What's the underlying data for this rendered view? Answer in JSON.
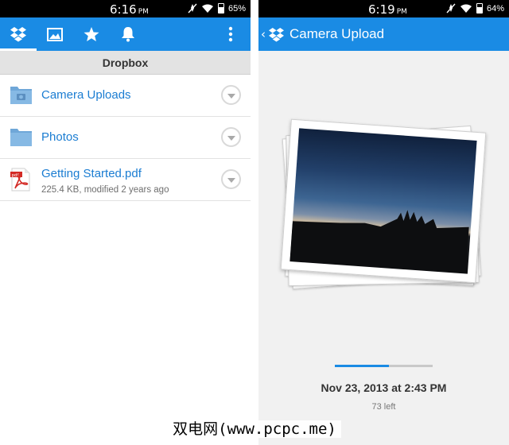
{
  "left_screen": {
    "status_bar": {
      "time": "6:16",
      "ampm": "PM",
      "battery": "65%"
    },
    "tabs": [
      {
        "name": "dropbox-logo-icon",
        "active": true
      },
      {
        "name": "photos-icon",
        "active": false
      },
      {
        "name": "favorites-star-icon",
        "active": false
      },
      {
        "name": "notifications-bell-icon",
        "active": false
      }
    ],
    "section_title": "Dropbox",
    "items": [
      {
        "title": "Camera Uploads",
        "icon": "camera-folder-icon"
      },
      {
        "title": "Photos",
        "icon": "folder-icon"
      },
      {
        "title": "Getting Started.pdf",
        "subtitle": "225.4 KB, modified 2 years ago",
        "icon": "pdf-file-icon"
      }
    ]
  },
  "right_screen": {
    "status_bar": {
      "time": "6:19",
      "ampm": "PM",
      "battery": "64%"
    },
    "title": "Camera Upload",
    "progress_fraction": 0.55,
    "upload_time": "Nov 23, 2013 at 2:43 PM",
    "remaining": "73 left"
  },
  "watermark": "双电网(www.pcpc.me)",
  "colors": {
    "brand_blue": "#1a8be4",
    "link_blue": "#1b7dd2",
    "header_gray": "#e3e3e3"
  }
}
